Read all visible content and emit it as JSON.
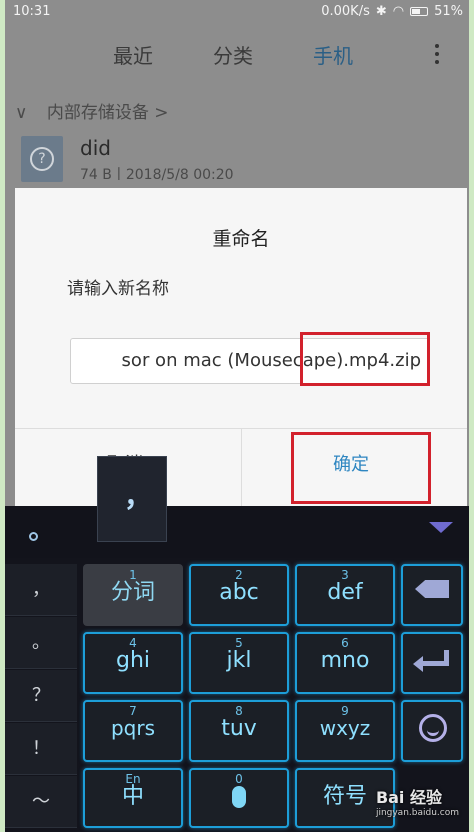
{
  "status": {
    "time": "10:31",
    "network": "0.00K/s",
    "battery": "51%"
  },
  "tabs": {
    "recent": "最近",
    "category": "分类",
    "phone": "手机"
  },
  "breadcrumb": {
    "chevron": "∨",
    "label": "内部存储设备 >"
  },
  "file": {
    "name": "did",
    "meta": "74 B丨2018/5/8 00:20"
  },
  "dialog": {
    "title": "重命名",
    "message": "请输入新名称",
    "input_value": "sor on mac (Mousecape).mp4.zip",
    "cancel_label": "取消",
    "confirm_label": "确定"
  },
  "keyboard": {
    "popup_char": "，",
    "left_column": [
      "，",
      "。",
      "？",
      "！",
      "～"
    ],
    "rows": [
      {
        "num": "1",
        "label": "分词"
      },
      {
        "num": "2",
        "label": "abc"
      },
      {
        "num": "3",
        "label": "def"
      },
      {
        "num": "4",
        "label": "ghi"
      },
      {
        "num": "5",
        "label": "jkl"
      },
      {
        "num": "6",
        "label": "mno"
      },
      {
        "num": "7",
        "label": "pqrs"
      },
      {
        "num": "8",
        "label": "tuv"
      },
      {
        "num": "9",
        "label": "wxyz"
      }
    ],
    "bottom": {
      "lang_top": "En",
      "lang_main": "中",
      "zero": "0",
      "symbols": "符号"
    }
  },
  "watermark": {
    "brand": "Bai 经验",
    "url": "jingyan.baidu.com"
  },
  "colors": {
    "accent": "#2e86c1",
    "highlight_box": "#d2212c",
    "key_glow": "#1d9ed8"
  }
}
